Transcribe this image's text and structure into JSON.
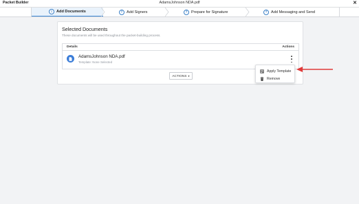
{
  "titlebar": {
    "app_name": "Packet Builder",
    "document": "AdamsJohnson NDA.pdf",
    "close_glyph": "✕"
  },
  "steps": [
    {
      "num": "1",
      "label": "Add Documents",
      "active": true
    },
    {
      "num": "2",
      "label": "Add Signers",
      "active": false
    },
    {
      "num": "3",
      "label": "Prepare for Signature",
      "active": false
    },
    {
      "num": "4",
      "label": "Add Messaging and Send",
      "active": false
    }
  ],
  "card": {
    "title": "Selected Documents",
    "subtitle": "These documents will be used throughout the packet-building process.",
    "table": {
      "col_details": "Details",
      "col_actions": "Actions",
      "rows": [
        {
          "file_name": "AdamsJohnson NDA.pdf",
          "template": "Template: None Selected",
          "icon": "document-icon"
        }
      ]
    },
    "actions_button": "ACTIONS",
    "actions_caret": "▾"
  },
  "context_menu": {
    "items": [
      {
        "label": "Apply Template",
        "icon": "template-icon"
      },
      {
        "label": "Remove",
        "icon": "trash-icon"
      }
    ]
  },
  "colors": {
    "accent": "#3a86d4",
    "annotation_arrow": "#e03a3a"
  }
}
